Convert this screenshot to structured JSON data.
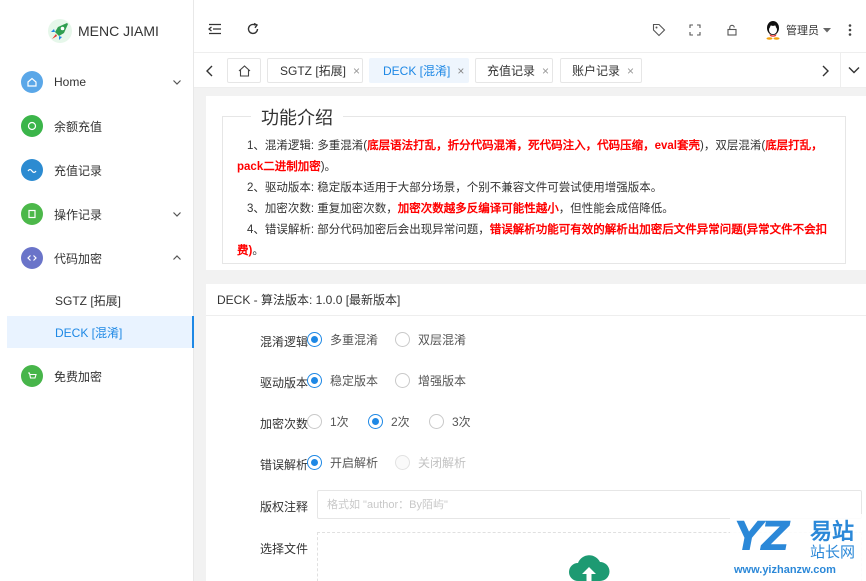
{
  "sidebar": {
    "logo_text": "MENC JIAMI",
    "items": [
      {
        "label": "Home",
        "icon": "home-icon",
        "color": "#5aa7e8"
      },
      {
        "label": "余额充值",
        "icon": "money-icon",
        "color": "#3bb54a"
      },
      {
        "label": "充值记录",
        "icon": "record-icon",
        "color": "#2c8bd1"
      },
      {
        "label": "操作记录",
        "icon": "edit-icon",
        "color": "#4cb84a"
      },
      {
        "label": "代码加密",
        "icon": "code-icon",
        "color": "#6a74c9"
      },
      {
        "label": "免费加密",
        "icon": "cart-icon",
        "color": "#47b54a"
      }
    ],
    "subitems": [
      {
        "label": "SGTZ [拓展]"
      },
      {
        "label": "DECK [混淆]"
      }
    ]
  },
  "topbar": {
    "user_name": "管理员"
  },
  "tabs": [
    {
      "label": "SGTZ [拓展]"
    },
    {
      "label": "DECK [混淆]"
    },
    {
      "label": "充值记录"
    },
    {
      "label": "账户记录"
    }
  ],
  "intro": {
    "title": "功能介绍",
    "p1_a": "1、混淆逻辑: 多重混淆(",
    "p1_b": "底层语法打乱，折分代码混淆，死代码注入，代码压缩，eval套壳",
    "p1_c": ")，双层混淆(",
    "p1_d": "底层打乱，pack二进制加密",
    "p1_e": ")。",
    "p2": "2、驱动版本: 稳定版本适用于大部分场景，个别不兼容文件可尝试使用增强版本。",
    "p3_a": "3、加密次数: 重复加密次数，",
    "p3_b": "加密次数越多反编译可能性越小",
    "p3_c": "，但性能会成倍降低。",
    "p4_a": "4、错误解析: 部分代码加密后会出现异常问题，",
    "p4_b": "错误解析功能可有效的解析出加密后文件异常问题(异常文件不会扣费)",
    "p4_c": "。"
  },
  "form": {
    "header": "DECK - 算法版本: 1.0.0 [最新版本]",
    "rows": [
      {
        "label": "混淆逻辑",
        "options": [
          "多重混淆",
          "双层混淆"
        ],
        "selected": "多重混淆"
      },
      {
        "label": "驱动版本",
        "options": [
          "稳定版本",
          "增强版本"
        ],
        "selected": "稳定版本"
      },
      {
        "label": "加密次数",
        "options": [
          "1次",
          "2次",
          "3次"
        ],
        "selected": "2次"
      },
      {
        "label": "错误解析",
        "options": [
          "开启解析",
          "关闭解析"
        ],
        "selected": "开启解析"
      }
    ],
    "copyright_label": "版权注释",
    "copyright_placeholder": "格式如 \"author：By陌屿\"",
    "file_label": "选择文件"
  },
  "watermark": {
    "logo": "YZ",
    "cn1": "易站",
    "cn2": "站长网",
    "url": "www.yizhanzw.com"
  },
  "colors": {
    "accent": "#1e88e5",
    "red": "#ff0000"
  }
}
